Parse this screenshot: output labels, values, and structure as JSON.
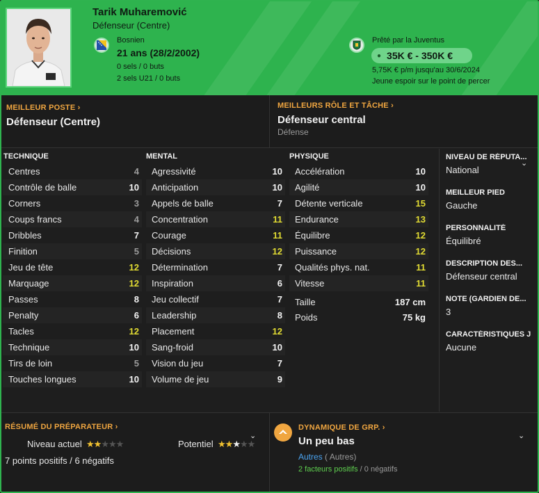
{
  "header": {
    "name": "Tarik Muharemović",
    "role": "Défenseur (Centre)",
    "nationality": "Bosnien",
    "age": "21 ans (28/2/2002)",
    "caps": "0 sels / 0 buts",
    "caps_u21": "2 sels U21 / 0 buts",
    "loan": "Prêté par la Juventus",
    "value": "35K € - 350K €",
    "wage": "5,75K € p/m jusqu'au 30/6/2024",
    "status": "Jeune espoir sur le point de percer"
  },
  "best_position": {
    "title": "MEILLEUR POSTE",
    "value": "Défenseur (Centre)"
  },
  "best_role": {
    "title": "MEILLEURS RÔLE ET TÂCHE",
    "value": "Défenseur central",
    "sub": "Défense"
  },
  "technical": {
    "title": "TECHNIQUE",
    "rows": [
      {
        "label": "Centres",
        "value": "4",
        "tone": "grey"
      },
      {
        "label": "Contrôle de balle",
        "value": "10",
        "tone": "white"
      },
      {
        "label": "Corners",
        "value": "3",
        "tone": "grey"
      },
      {
        "label": "Coups francs",
        "value": "4",
        "tone": "grey"
      },
      {
        "label": "Dribbles",
        "value": "7",
        "tone": "white"
      },
      {
        "label": "Finition",
        "value": "5",
        "tone": "grey"
      },
      {
        "label": "Jeu de tête",
        "value": "12",
        "tone": "yellow"
      },
      {
        "label": "Marquage",
        "value": "12",
        "tone": "yellow"
      },
      {
        "label": "Passes",
        "value": "8",
        "tone": "white"
      },
      {
        "label": "Penalty",
        "value": "6",
        "tone": "white"
      },
      {
        "label": "Tacles",
        "value": "12",
        "tone": "yellow"
      },
      {
        "label": "Technique",
        "value": "10",
        "tone": "white"
      },
      {
        "label": "Tirs de loin",
        "value": "5",
        "tone": "grey"
      },
      {
        "label": "Touches longues",
        "value": "10",
        "tone": "white"
      }
    ]
  },
  "mental": {
    "title": "MENTAL",
    "rows": [
      {
        "label": "Agressivité",
        "value": "10",
        "tone": "white"
      },
      {
        "label": "Anticipation",
        "value": "10",
        "tone": "white"
      },
      {
        "label": "Appels de balle",
        "value": "7",
        "tone": "white"
      },
      {
        "label": "Concentration",
        "value": "11",
        "tone": "yellow"
      },
      {
        "label": "Courage",
        "value": "11",
        "tone": "yellow"
      },
      {
        "label": "Décisions",
        "value": "12",
        "tone": "yellow"
      },
      {
        "label": "Détermination",
        "value": "7",
        "tone": "white"
      },
      {
        "label": "Inspiration",
        "value": "6",
        "tone": "white"
      },
      {
        "label": "Jeu collectif",
        "value": "7",
        "tone": "white"
      },
      {
        "label": "Leadership",
        "value": "8",
        "tone": "white"
      },
      {
        "label": "Placement",
        "value": "12",
        "tone": "yellow"
      },
      {
        "label": "Sang-froid",
        "value": "10",
        "tone": "white"
      },
      {
        "label": "Vision du jeu",
        "value": "7",
        "tone": "white"
      },
      {
        "label": "Volume de jeu",
        "value": "9",
        "tone": "white"
      }
    ]
  },
  "physical": {
    "title": "PHYSIQUE",
    "rows": [
      {
        "label": "Accélération",
        "value": "10",
        "tone": "white"
      },
      {
        "label": "Agilité",
        "value": "10",
        "tone": "white"
      },
      {
        "label": "Détente verticale",
        "value": "15",
        "tone": "yellow"
      },
      {
        "label": "Endurance",
        "value": "13",
        "tone": "yellow"
      },
      {
        "label": "Équilibre",
        "value": "12",
        "tone": "yellow"
      },
      {
        "label": "Puissance",
        "value": "12",
        "tone": "yellow"
      },
      {
        "label": "Qualités phys. nat.",
        "value": "11",
        "tone": "yellow"
      },
      {
        "label": "Vitesse",
        "value": "11",
        "tone": "yellow"
      }
    ],
    "height_label": "Taille",
    "height": "187 cm",
    "weight_label": "Poids",
    "weight": "75 kg"
  },
  "side": [
    {
      "title": "NIVEAU DE RÉPUTA...",
      "value": "National"
    },
    {
      "title": "MEILLEUR PIED",
      "value": "Gauche"
    },
    {
      "title": "PERSONNALITÉ",
      "value": "Équilibré"
    },
    {
      "title": "DESCRIPTION DES...",
      "value": "Défenseur central"
    },
    {
      "title": "NOTE (GARDIEN DE...",
      "value": "3"
    },
    {
      "title": "CARACTÉRISTIQUES J",
      "value": "Aucune"
    }
  ],
  "coach": {
    "title": "RÉSUMÉ DU PRÉPARATEUR",
    "current_label": "Niveau actuel",
    "current_stars": 2,
    "potential_label": "Potentiel",
    "potential_stars": 2.5,
    "summary": "7 points positifs / 6 négatifs"
  },
  "dynamics": {
    "title": "DYNAMIQUE DE GRP.",
    "value": "Un peu bas",
    "group_link": "Autres",
    "group_sub": "( Autres)",
    "positive": "2 facteurs positifs",
    "separator": "/",
    "negative": "0 négatifs"
  },
  "colors": {
    "header_green": "#2eb34e",
    "accent_orange": "#f0a640",
    "highlight_yellow": "#e2dc33",
    "link_blue": "#4aa3f0"
  }
}
